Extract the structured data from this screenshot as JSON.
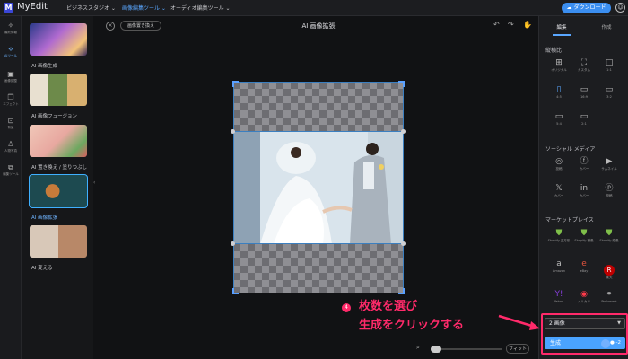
{
  "app": {
    "logo_letter": "M",
    "name": "MyEdit"
  },
  "topnav": {
    "items": [
      "ビジネススタジオ ⌄",
      "画像編集ツール ⌄",
      "オーディオ編集ツール ⌄"
    ],
    "download_label": "ダウンロード"
  },
  "rail": {
    "items": [
      {
        "icon": "✧",
        "label": "最終情報"
      },
      {
        "icon": "⟡",
        "label": "AIツール"
      },
      {
        "icon": "▣",
        "label": "画像調整"
      },
      {
        "icon": "❐",
        "label": "エフェクト"
      },
      {
        "icon": "⊡",
        "label": "背景"
      },
      {
        "icon": "♙",
        "label": "人物写真"
      },
      {
        "icon": "⧉",
        "label": "編集ツール"
      }
    ]
  },
  "tools": {
    "items": [
      {
        "label": "AI 画像生成"
      },
      {
        "label": "AI 画像フュージョン"
      },
      {
        "label": "AI 置き換え / 塗りつぶし"
      },
      {
        "label": "AI 画像拡張"
      },
      {
        "label": "AI 変える"
      }
    ]
  },
  "canvas": {
    "replace_label": "画像置き換え",
    "title": "AI 画像拡張",
    "fit_label": "フィット"
  },
  "right_panel": {
    "tabs": [
      "編集",
      "作成"
    ],
    "ratio_section": "縦横比",
    "ratio_options": [
      {
        "icon": "⊞",
        "label": "オリジナル"
      },
      {
        "icon": "⛶",
        "label": "カスタム"
      },
      {
        "icon": "□",
        "label": "1:1"
      },
      {
        "icon": "▯",
        "label": "4:5"
      },
      {
        "icon": "▭",
        "label": "16:9"
      },
      {
        "icon": "▭",
        "label": "3:2"
      },
      {
        "icon": "▭",
        "label": "5:4"
      },
      {
        "icon": "▭",
        "label": "2:1"
      }
    ],
    "social_section": "ソーシャル メディア",
    "social_options": [
      {
        "icon": "◎",
        "label": "投稿"
      },
      {
        "icon": "ⓕ",
        "label": "カバー"
      },
      {
        "icon": "▶",
        "label": "サムネイル"
      },
      {
        "icon": "𝕏",
        "label": "カバー"
      },
      {
        "icon": "in",
        "label": "カバー"
      },
      {
        "icon": "ⓟ",
        "label": "投稿"
      }
    ],
    "market_section": "マーケットプレイス",
    "market_options": [
      {
        "icon": "⛊",
        "label": "Shopify 正方形"
      },
      {
        "icon": "⛊",
        "label": "Shopify 横長"
      },
      {
        "icon": "⛊",
        "label": "Shopify 縦長"
      },
      {
        "icon": "a",
        "label": "Amazon"
      },
      {
        "icon": "e",
        "label": "eBay"
      },
      {
        "icon": "R",
        "label": "楽天"
      },
      {
        "icon": "Y!",
        "label": "Yahoo"
      },
      {
        "icon": "◉",
        "label": "メルカリ"
      },
      {
        "icon": "⚭",
        "label": "Poshmark"
      }
    ],
    "count_value": "2 画像",
    "generate_label": "生成",
    "generate_credit": "-2"
  },
  "annotation": {
    "number": "4",
    "line1": "枚数を選び",
    "line2": "生成をクリックする"
  },
  "colors": {
    "accent": "#4aa3ff",
    "annotation": "#ff2a6a"
  }
}
